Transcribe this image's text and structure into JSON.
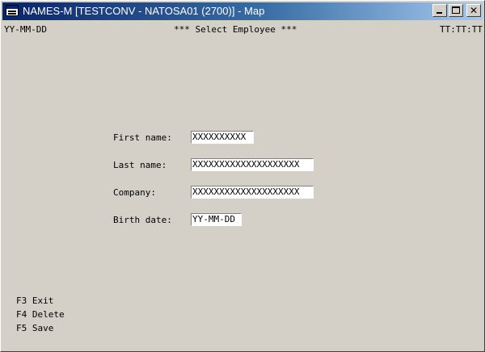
{
  "window": {
    "title": "NAMES-M [TESTCONV - NATOSA01 (2700)] - Map"
  },
  "header": {
    "date": "YY-MM-DD",
    "title": "*** Select Employee ***",
    "time": "TT:TT:TT"
  },
  "form": {
    "first_name": {
      "label": "First name:",
      "value": "XXXXXXXXXX"
    },
    "last_name": {
      "label": "Last name:",
      "value": "XXXXXXXXXXXXXXXXXXXX"
    },
    "company": {
      "label": "Company:",
      "value": "XXXXXXXXXXXXXXXXXXXX"
    },
    "birth_date": {
      "label": "Birth date:",
      "value": "YY-MM-DD"
    }
  },
  "function_keys": [
    {
      "label": "F3 Exit"
    },
    {
      "label": "F4 Delete"
    },
    {
      "label": "F5 Save"
    }
  ]
}
